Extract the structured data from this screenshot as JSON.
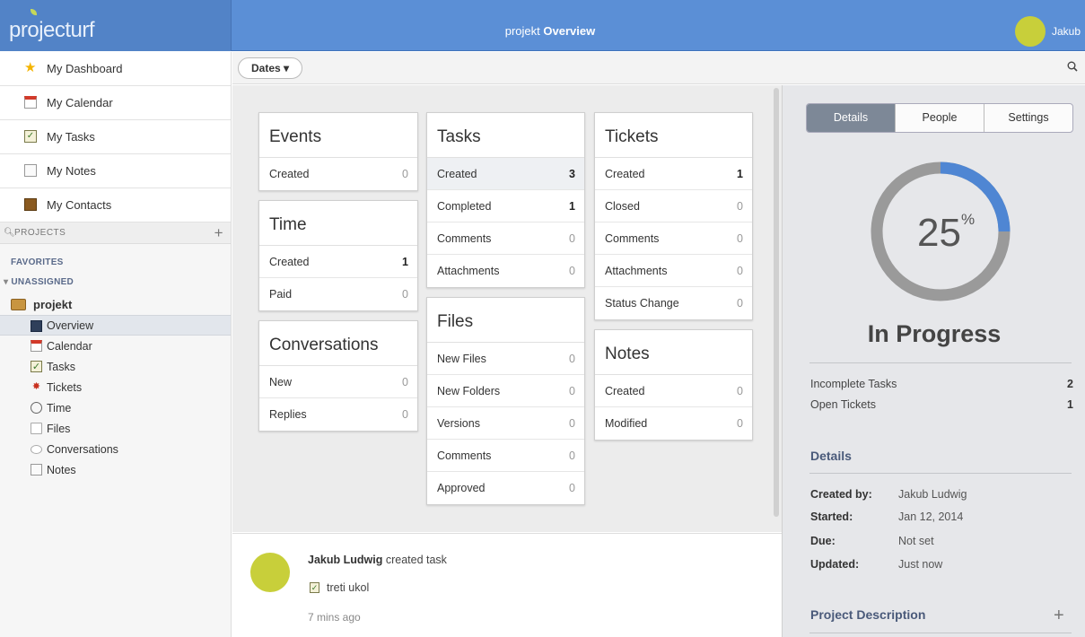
{
  "app": {
    "logo": "projecturf",
    "title_prefix": "projekt",
    "title_main": "Overview",
    "user": "Jakub"
  },
  "sidebar": {
    "links": [
      {
        "label": "My Dashboard",
        "icon": "star-icon"
      },
      {
        "label": "My Calendar",
        "icon": "calendar-icon"
      },
      {
        "label": "My Tasks",
        "icon": "tasks-icon"
      },
      {
        "label": "My Notes",
        "icon": "notes-icon"
      },
      {
        "label": "My Contacts",
        "icon": "contacts-icon"
      }
    ],
    "projects_label": "PROJECTS",
    "favorites_label": "FAVORITES",
    "unassigned_label": "UNASSIGNED",
    "project_name": "projekt",
    "project_items": [
      {
        "label": "Overview",
        "icon": "overview-icon",
        "active": true
      },
      {
        "label": "Calendar",
        "icon": "calendar-icon"
      },
      {
        "label": "Tasks",
        "icon": "tasks-icon"
      },
      {
        "label": "Tickets",
        "icon": "tickets-icon"
      },
      {
        "label": "Time",
        "icon": "clock-icon"
      },
      {
        "label": "Files",
        "icon": "file-icon"
      },
      {
        "label": "Conversations",
        "icon": "conversation-icon"
      },
      {
        "label": "Notes",
        "icon": "notes-icon"
      }
    ]
  },
  "toolbar": {
    "dates_label": "Dates ▾"
  },
  "widgets": {
    "events": {
      "title": "Events",
      "rows": [
        {
          "label": "Created",
          "value": "0"
        }
      ]
    },
    "time": {
      "title": "Time",
      "rows": [
        {
          "label": "Created",
          "value": "1"
        },
        {
          "label": "Paid",
          "value": "0"
        }
      ]
    },
    "conversations": {
      "title": "Conversations",
      "rows": [
        {
          "label": "New",
          "value": "0"
        },
        {
          "label": "Replies",
          "value": "0"
        }
      ]
    },
    "tasks": {
      "title": "Tasks",
      "rows": [
        {
          "label": "Created",
          "value": "3"
        },
        {
          "label": "Completed",
          "value": "1"
        },
        {
          "label": "Comments",
          "value": "0"
        },
        {
          "label": "Attachments",
          "value": "0"
        }
      ]
    },
    "files": {
      "title": "Files",
      "rows": [
        {
          "label": "New Files",
          "value": "0"
        },
        {
          "label": "New Folders",
          "value": "0"
        },
        {
          "label": "Versions",
          "value": "0"
        },
        {
          "label": "Comments",
          "value": "0"
        },
        {
          "label": "Approved",
          "value": "0"
        }
      ]
    },
    "tickets": {
      "title": "Tickets",
      "rows": [
        {
          "label": "Created",
          "value": "1"
        },
        {
          "label": "Closed",
          "value": "0"
        },
        {
          "label": "Comments",
          "value": "0"
        },
        {
          "label": "Attachments",
          "value": "0"
        },
        {
          "label": "Status Change",
          "value": "0"
        }
      ]
    },
    "notes": {
      "title": "Notes",
      "rows": [
        {
          "label": "Created",
          "value": "0"
        },
        {
          "label": "Modified",
          "value": "0"
        }
      ]
    }
  },
  "activity": {
    "user": "Jakub Ludwig",
    "action": "created task",
    "task_name": "treti ukol",
    "time": "7 mins ago"
  },
  "right_panel": {
    "tabs": [
      "Details",
      "People",
      "Settings"
    ],
    "active_tab": "Details",
    "progress_value": "25",
    "progress_unit": "%",
    "progress_fraction": 0.25,
    "status": "In Progress",
    "stats": [
      {
        "label": "Incomplete Tasks",
        "value": "2"
      },
      {
        "label": "Open Tickets",
        "value": "1"
      }
    ],
    "details_heading": "Details",
    "details": [
      {
        "key": "Created by:",
        "value": "Jakub Ludwig"
      },
      {
        "key": "Started:",
        "value": "Jan 12, 2014"
      },
      {
        "key": "Due:",
        "value": "Not set"
      },
      {
        "key": "Updated:",
        "value": "Just now"
      }
    ],
    "description_heading": "Project Description"
  },
  "colors": {
    "accent": "#5b8fd6",
    "ring_track": "#9a9a9a",
    "ring_progress": "#4f86d3",
    "avatar": "#c8cf3a"
  }
}
